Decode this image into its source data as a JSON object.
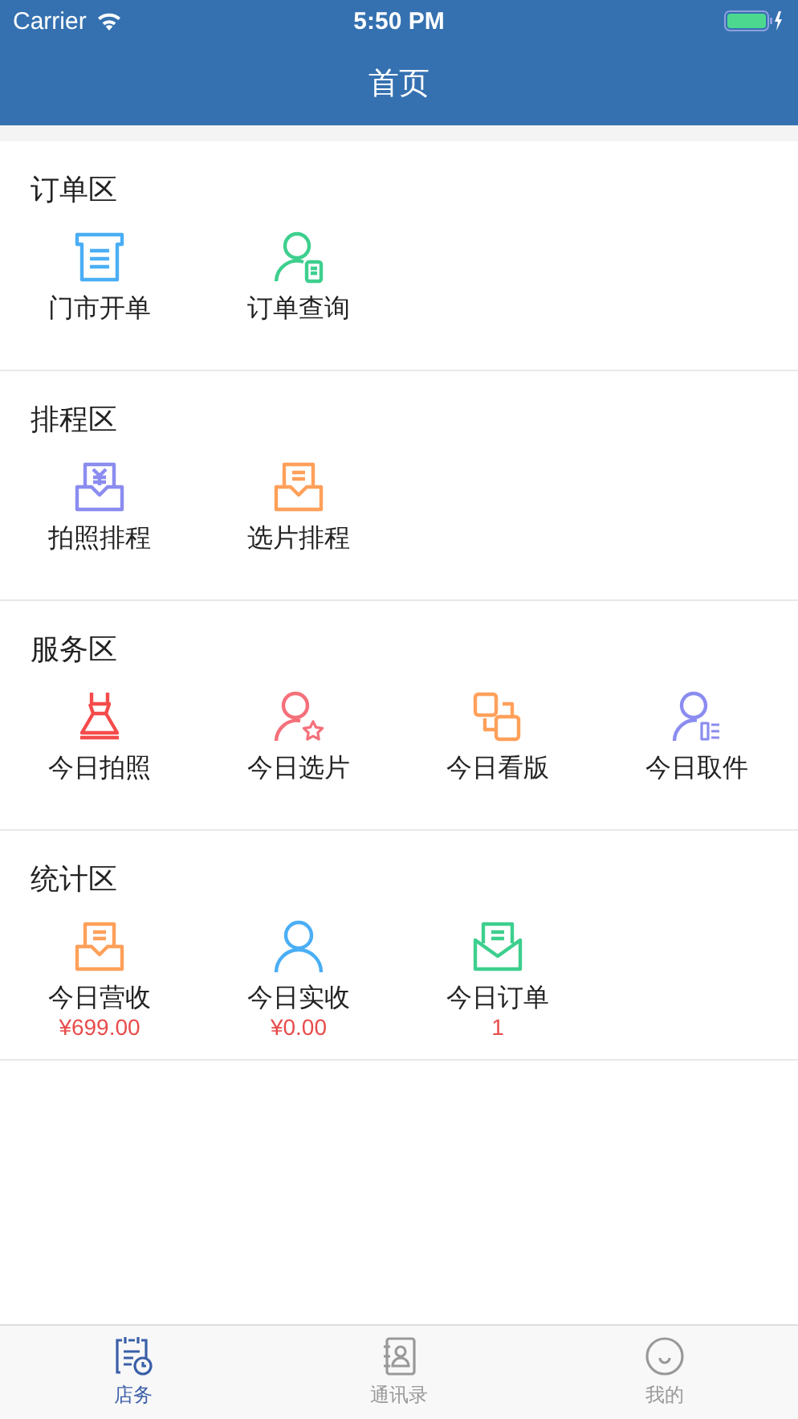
{
  "status_bar": {
    "carrier": "Carrier",
    "time": "5:50 PM"
  },
  "nav": {
    "title": "首页"
  },
  "sections": [
    {
      "title": "订单区",
      "items": [
        {
          "label": "门市开单",
          "kind": "receipt",
          "color": "#4aaef5"
        },
        {
          "label": "订单查询",
          "kind": "person-doc",
          "color": "#3dcf8e"
        }
      ]
    },
    {
      "title": "排程区",
      "items": [
        {
          "label": "拍照排程",
          "kind": "tray-yen",
          "color": "#8b8cf0"
        },
        {
          "label": "选片排程",
          "kind": "tray-doc",
          "color": "#ffa05a"
        }
      ]
    },
    {
      "title": "服务区",
      "items": [
        {
          "label": "今日拍照",
          "kind": "dress",
          "color": "#f54b4b"
        },
        {
          "label": "今日选片",
          "kind": "person-star",
          "color": "#f5707a"
        },
        {
          "label": "今日看版",
          "kind": "squares",
          "color": "#ffa05a"
        },
        {
          "label": "今日取件",
          "kind": "person-list",
          "color": "#8b8cf0"
        }
      ]
    },
    {
      "title": "统计区",
      "items": [
        {
          "label": "今日营收",
          "kind": "tray-doc",
          "color": "#ffa05a",
          "value": "¥699.00"
        },
        {
          "label": "今日实收",
          "kind": "person",
          "color": "#4aaef5",
          "value": "¥0.00"
        },
        {
          "label": "今日订单",
          "kind": "envelope",
          "color": "#3dcf8e",
          "value": "1"
        }
      ]
    }
  ],
  "tabs": [
    {
      "label": "店务",
      "kind": "calendar",
      "selected": true
    },
    {
      "label": "通讯录",
      "kind": "contacts",
      "selected": false
    },
    {
      "label": "我的",
      "kind": "face",
      "selected": false
    }
  ]
}
